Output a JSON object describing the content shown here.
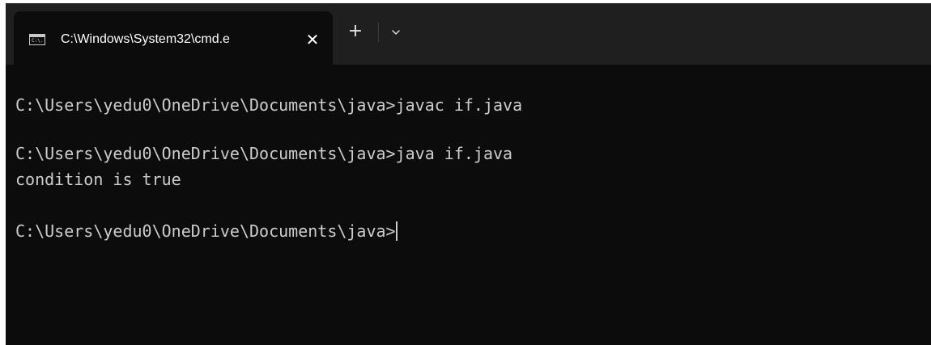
{
  "tab": {
    "icon": "command-prompt-icon",
    "icon_text": "C:\\.",
    "title": "C:\\Windows\\System32\\cmd.e",
    "close_icon": "close-icon"
  },
  "toolbar": {
    "new_tab_icon": "plus-icon",
    "dropdown_icon": "chevron-down-icon"
  },
  "terminal": {
    "lines": [
      "C:\\Users\\yedu0\\OneDrive\\Documents\\java>javac if.java",
      "",
      "C:\\Users\\yedu0\\OneDrive\\Documents\\java>java if.java",
      "condition is true",
      "",
      "C:\\Users\\yedu0\\OneDrive\\Documents\\java>"
    ]
  },
  "colors": {
    "background": "#0c0c0c",
    "titlebar": "#1f1f1f",
    "text": "#cccccc"
  }
}
